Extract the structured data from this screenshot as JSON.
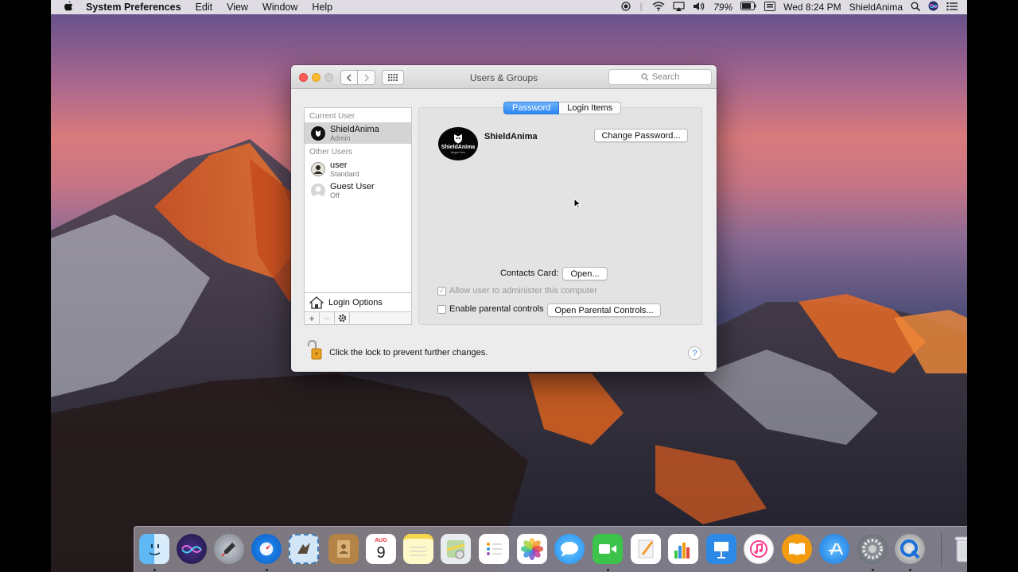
{
  "menubar": {
    "app_name": "System Preferences",
    "menus": [
      "Edit",
      "View",
      "Window",
      "Help"
    ],
    "battery": "79%",
    "clock": "Wed 8:24 PM",
    "user": "ShieldAnima"
  },
  "window": {
    "title": "Users & Groups",
    "search_placeholder": "Search"
  },
  "sidebar": {
    "current_user_header": "Current User",
    "current_user": {
      "name": "ShieldAnima",
      "role": "Admin"
    },
    "other_users_header": "Other Users",
    "other_users": [
      {
        "name": "user",
        "role": "Standard"
      },
      {
        "name": "Guest User",
        "role": "Off"
      }
    ],
    "login_options": "Login Options",
    "add_symbol": "+",
    "remove_symbol": "−"
  },
  "tabs": [
    "Password",
    "Login Items"
  ],
  "profile": {
    "name": "ShieldAnima",
    "avatar_text": "ShieldAnima",
    "avatar_sub": "slogan here",
    "change_password_label": "Change Password..."
  },
  "contacts_card": {
    "label": "Contacts Card:",
    "button": "Open..."
  },
  "options": {
    "admin_label": "Allow user to administer this computer",
    "admin_checked": true,
    "parental_label": "Enable parental controls",
    "parental_checked": false,
    "parental_button": "Open Parental Controls..."
  },
  "footer": {
    "lock_message": "Click the lock to prevent further changes.",
    "help_symbol": "?"
  },
  "dock": {
    "calendar_month": "AUG",
    "calendar_day": "9",
    "apps": [
      "Finder",
      "Siri",
      "Launchpad",
      "Safari",
      "Mail",
      "Contacts",
      "Calendar",
      "Notes",
      "Reminders",
      "Photos",
      "Messages",
      "FaceTime",
      "Pages",
      "Numbers",
      "Keynote",
      "iTunes",
      "iBooks",
      "App Store",
      "System Preferences",
      "QuickTime Player",
      "Trash"
    ]
  }
}
